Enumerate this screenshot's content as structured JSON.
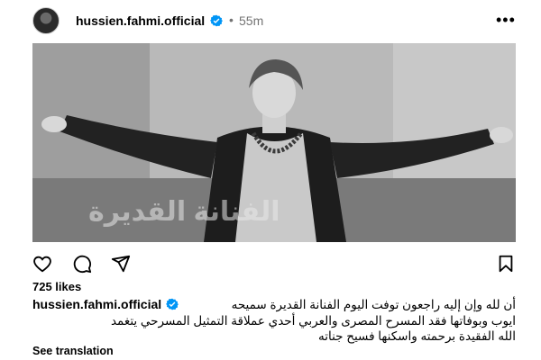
{
  "post": {
    "username": "hussien.fahmi.official",
    "dot": "•",
    "time": "55m",
    "more_icon": "more-options-icon",
    "photo_overlay_text": "الفنانة القديرة",
    "likes": "725 likes",
    "caption": {
      "username": "hussien.fahmi.official",
      "line1": "أن لله وإن إليه راجعون توفت اليوم الفنانة القديرة سميحه",
      "line2": "ايوب وبوفاتها فقد المسرح المصرى والعربي أحدي عملاقة التمثيل المسرحي يتغمد",
      "line3": "الله الفقيدة برحمته واسكنها فسيح جناته"
    },
    "see_translation": "See translation"
  },
  "icons": {
    "verified": "verified-badge-icon",
    "like": "heart-icon",
    "comment": "comment-icon",
    "share": "share-icon",
    "save": "bookmark-icon"
  },
  "colors": {
    "verified": "#0095f6",
    "muted": "#737373"
  }
}
